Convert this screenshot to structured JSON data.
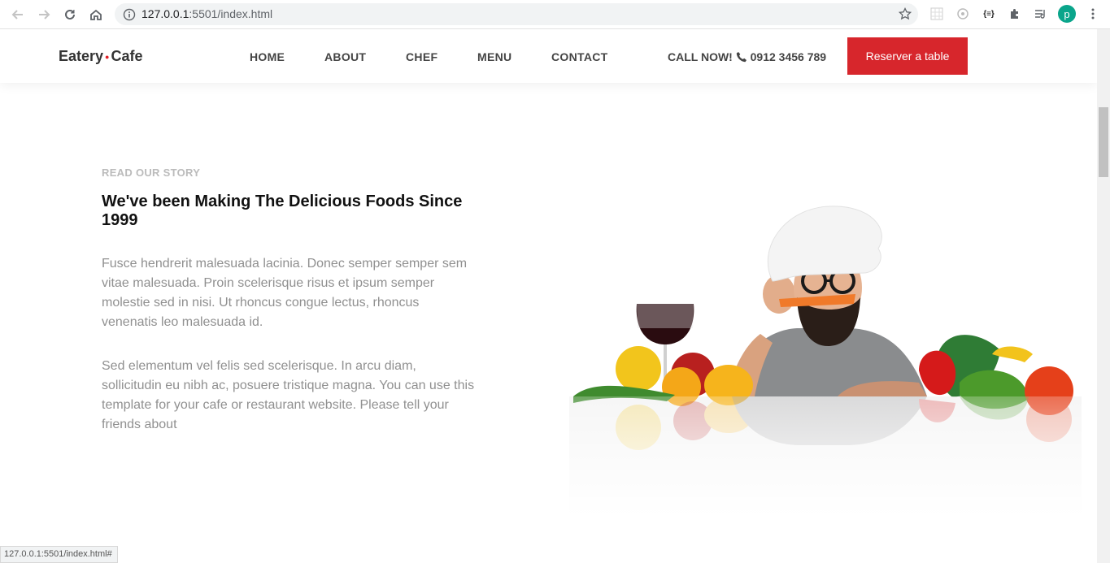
{
  "browser": {
    "url_host": "127.0.0.1",
    "url_path": ":5501/index.html",
    "avatar_letter": "p",
    "status_url": "127.0.0.1:5501/index.html#",
    "extension_label": "{≡}"
  },
  "header": {
    "logo_left": "Eatery",
    "logo_dot": "●",
    "logo_right": "Cafe",
    "menu": [
      "HOME",
      "ABOUT",
      "CHEF",
      "MENU",
      "CONTACT"
    ],
    "call_label": "CALL NOW!",
    "phone": "0912 3456 789",
    "reserve_label": "Reserver a table"
  },
  "story": {
    "eyebrow": "READ OUR STORY",
    "heading": "We've been Making The Delicious Foods Since 1999",
    "para1": "Fusce hendrerit malesuada lacinia. Donec semper semper sem vitae malesuada. Proin scelerisque risus et ipsum semper molestie sed in nisi. Ut rhoncus congue lectus, rhoncus venenatis leo malesuada id.",
    "para2": "Sed elementum vel felis sed scelerisque. In arcu diam, sollicitudin eu nibh ac, posuere tristique magna. You can use this template for your cafe or restaurant website. Please tell your friends about"
  },
  "colors": {
    "accent": "#d7262c",
    "text_muted": "#909090",
    "eyebrow": "#bbbbbb"
  }
}
